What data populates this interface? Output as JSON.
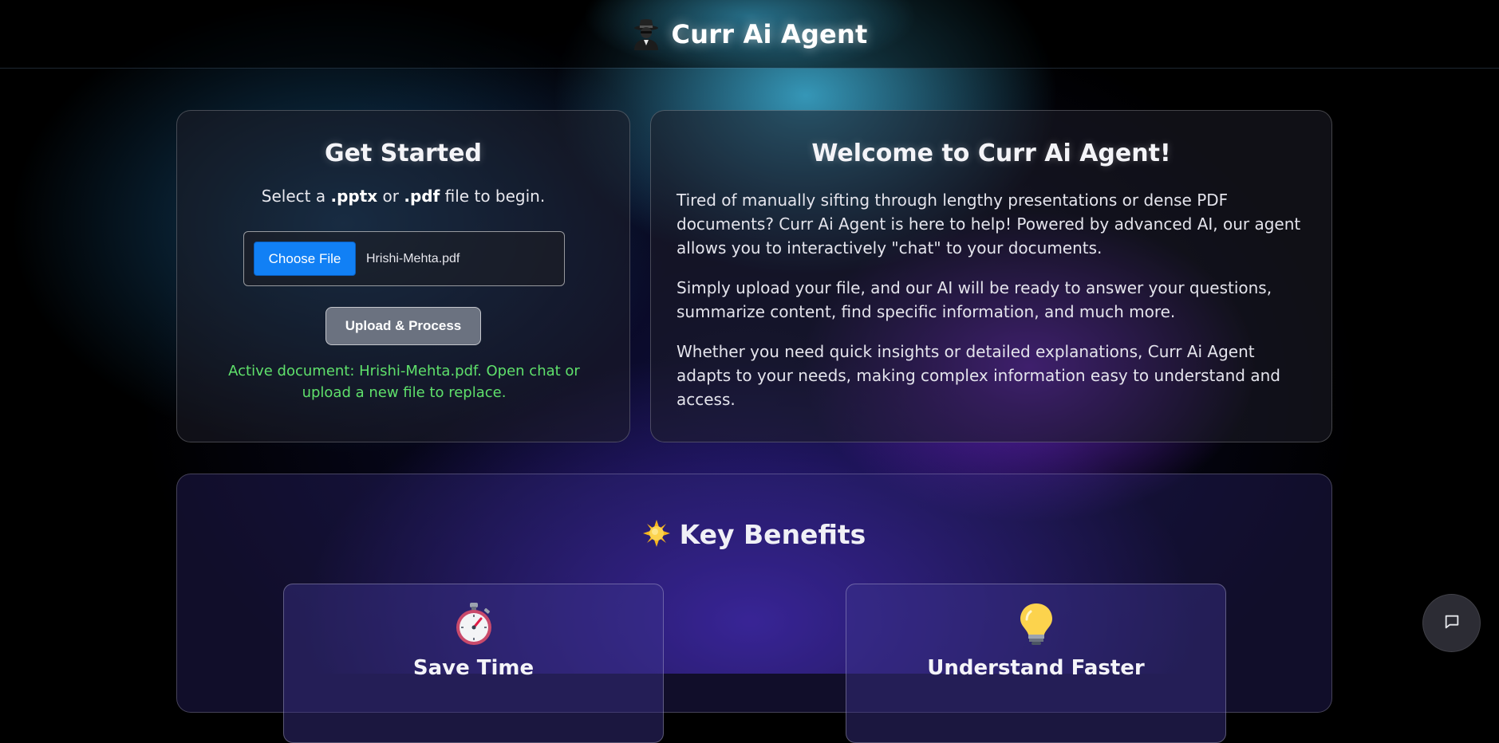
{
  "header": {
    "title": "Curr Ai Agent",
    "icon": "spy-agent-icon"
  },
  "get_started": {
    "title": "Get Started",
    "select_prefix": "Select a ",
    "ext_pptx": ".pptx",
    "select_or": " or ",
    "ext_pdf": ".pdf",
    "select_suffix": " file to begin.",
    "choose_file_label": "Choose File",
    "selected_file": "Hrishi-Mehta.pdf",
    "upload_label": "Upload & Process",
    "active_status": "Active document: Hrishi-Mehta.pdf. Open chat or upload a new file to replace."
  },
  "welcome": {
    "title": "Welcome to Curr Ai Agent!",
    "paragraphs": [
      "Tired of manually sifting through lengthy presentations or dense PDF documents? Curr Ai Agent is here to help! Powered by advanced AI, our agent allows you to interactively \"chat\" to your documents.",
      "Simply upload your file, and our AI will be ready to answer your questions, summarize content, find specific information, and much more.",
      "Whether you need quick insights or detailed explanations, Curr Ai Agent adapts to your needs, making complex information easy to understand and access."
    ]
  },
  "benefits": {
    "title": "Key Benefits",
    "icon": "sparkle-sun-icon",
    "items": [
      {
        "title": "Save Time",
        "icon": "stopwatch-icon"
      },
      {
        "title": "Understand Faster",
        "icon": "lightbulb-icon"
      }
    ]
  },
  "chat_fab": {
    "icon": "chat-bubble-icon"
  },
  "colors": {
    "accent_blue": "#1180f5",
    "status_green": "#5fe06b",
    "upload_button": "#6b7280"
  }
}
